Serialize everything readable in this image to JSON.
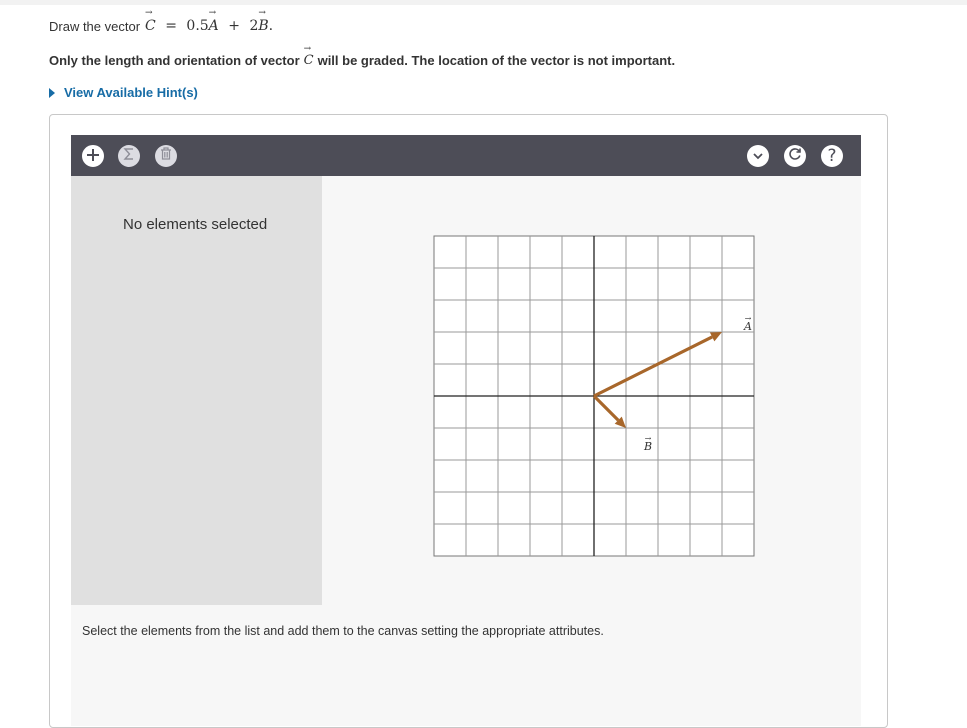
{
  "problem": {
    "prompt_text": "Draw the vector",
    "equation": {
      "lhs": "C",
      "equals": "=",
      "coef_a": "0.5",
      "vec_a": "A",
      "plus": "+",
      "coef_b": "2",
      "vec_b": "B",
      "end": "."
    },
    "note_before": "Only the length and orientation of vector",
    "note_vector": "C",
    "note_after": "will be graded. The location of the vector is not important.",
    "hint_label": "View Available Hint(s)"
  },
  "toolbar": {
    "left_icons": [
      "plus-icon",
      "sigma-icon",
      "trash-icon"
    ],
    "right_icons": [
      "chevron-down-icon",
      "reset-icon",
      "help-icon"
    ],
    "help_glyph": "?"
  },
  "side_panel": {
    "empty_text": "No elements selected"
  },
  "canvas": {
    "grid": {
      "columns": 10,
      "rows": 10,
      "origin_col": 5,
      "origin_row": 5
    },
    "vectors": [
      {
        "label": "A",
        "start": [
          0,
          0
        ],
        "end": [
          4,
          2
        ],
        "color": "#a8672b"
      },
      {
        "label": "B",
        "start": [
          0,
          0
        ],
        "end": [
          1,
          -1
        ],
        "color": "#a8672b"
      }
    ],
    "instructions": "Select the elements from the list and add them to the canvas setting the appropriate attributes."
  },
  "colors": {
    "toolbar": "#4d4d57",
    "link": "#176ca6",
    "vector": "#a8672b",
    "side_panel": "#e0e0e0"
  }
}
